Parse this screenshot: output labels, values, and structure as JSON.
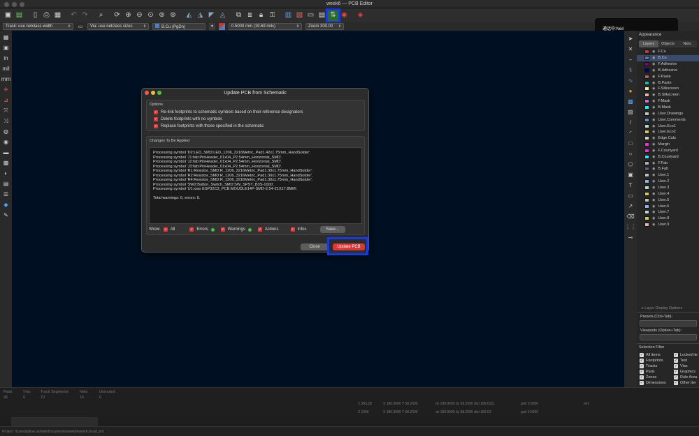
{
  "window": {
    "title": "week6 — PCB Editor"
  },
  "toolbar": {
    "icons": [
      "save-icon",
      "board-setup-icon",
      "page-icon",
      "print-icon",
      "plot-icon",
      "undo-icon",
      "redo-icon",
      "find-icon",
      "refresh-icon",
      "zoom-in-icon",
      "zoom-out-icon",
      "zoom-fit-icon",
      "zoom-objects-icon",
      "zoom-selection-icon",
      "rotate-ccw-icon",
      "rotate-cw-icon",
      "flip-icon",
      "mirror-icon",
      "group-icon",
      "ungroup-icon",
      "lock-icon",
      "unlock-icon",
      "footprint-editor-icon",
      "footprint-browser-icon",
      "update-pcb-from-schematic-icon",
      "drc-icon",
      "scripting-icon"
    ]
  },
  "toolbar2": {
    "track": "Track: use netclass width",
    "via": "Via: use netclass sizes",
    "layer": "B.Cu (PgDn)",
    "grid": "0.5000 mm (19.69 mils)",
    "zoom": "Zoom 300.00"
  },
  "notification": {
    "text": "通话中:Neil"
  },
  "left_tools": [
    "grid-icon",
    "polar-icon",
    "inches-icon",
    "mils-icon",
    "mm-icon",
    "cursor-icon",
    "line-width-icon",
    "ratsnest-icon",
    "curved-ratsnest-icon",
    "pads-icon",
    "vias-icon",
    "tracks-icon",
    "zones-icon",
    "high-contrast-icon",
    "appearance-icon",
    "layers-manager-icon",
    "3d-icon",
    "scripting-tool-icon"
  ],
  "left_tool_glyphs": [
    "▦",
    "▣",
    "in",
    "mil",
    "mm",
    "✛",
    "⊿",
    "⤧",
    "⤨",
    "◍",
    "◉",
    "▬",
    "▩",
    "◐",
    "▤",
    "☰",
    "◆",
    "✎"
  ],
  "right_tools": [
    "select-icon",
    "local-ratsnest-icon",
    "route-track-icon",
    "route-diff-icon",
    "tune-length-icon",
    "add-via-icon",
    "add-zone-icon",
    "add-rule-area-icon",
    "draw-line-icon",
    "draw-arc-icon",
    "draw-rect-icon",
    "draw-circle-icon",
    "draw-polygon-icon",
    "add-image-icon",
    "add-text-icon",
    "add-textbox-icon",
    "add-dimension-icon",
    "delete-icon",
    "grid-origin-icon",
    "measure-icon"
  ],
  "right_tool_glyphs": [
    "➤",
    "✕",
    "⌁",
    "⥮",
    "∿",
    "●",
    "▩",
    "▧",
    "/",
    "◜",
    "□",
    "○",
    "⬠",
    "▣",
    "T",
    "▭",
    "↗",
    "⌫",
    "⋮⋮",
    "⊸"
  ],
  "appearance": {
    "header": "Appearance",
    "tabs": [
      "Layers",
      "Objects",
      "Nets"
    ],
    "active_tab": "Layers",
    "layers": [
      {
        "name": "F.Cu",
        "color": "#c83434"
      },
      {
        "name": "B.Cu",
        "color": "#4d7fc4"
      },
      {
        "name": "F.Adhesive",
        "color": "#84008a"
      },
      {
        "name": "B.Adhesive",
        "color": "#00007c"
      },
      {
        "name": "F.Paste",
        "color": "#b46464"
      },
      {
        "name": "B.Paste",
        "color": "#00c2c2"
      },
      {
        "name": "F.Silkscreen",
        "color": "#f2eda1"
      },
      {
        "name": "B.Silkscreen",
        "color": "#e8b2a7"
      },
      {
        "name": "F.Mask",
        "color": "#d864ff"
      },
      {
        "name": "B.Mask",
        "color": "#02ffee"
      },
      {
        "name": "User.Drawings",
        "color": "#c2c2c2"
      },
      {
        "name": "User.Comments",
        "color": "#5994dc"
      },
      {
        "name": "User.Eco1",
        "color": "#b4db d2"
      },
      {
        "name": "User.Eco2",
        "color": "#d8c852"
      },
      {
        "name": "Edge.Cuts",
        "color": "#d0d2cd"
      },
      {
        "name": "Margin",
        "color": "#ff26e2"
      },
      {
        "name": "F.Courtyard",
        "color": "#ff26e2"
      },
      {
        "name": "B.Courtyard",
        "color": "#26e9ff"
      },
      {
        "name": "F.Fab",
        "color": "#afafaf"
      },
      {
        "name": "B.Fab",
        "color": "#585d84"
      },
      {
        "name": "User.1",
        "color": "#c2c2c2"
      },
      {
        "name": "User.2",
        "color": "#89b4f4"
      },
      {
        "name": "User.3",
        "color": "#b4dbd2"
      },
      {
        "name": "User.4",
        "color": "#d8c852"
      },
      {
        "name": "User.5",
        "color": "#c2c2c2"
      },
      {
        "name": "User.6",
        "color": "#89b4f4"
      },
      {
        "name": "User.7",
        "color": "#b4dbd2"
      },
      {
        "name": "User.8",
        "color": "#d8c852"
      },
      {
        "name": "User.9",
        "color": "#e8b2a7"
      }
    ],
    "layer_display_options": "▸ Layer Display Options",
    "presets_label": "Presets (Ctrl+Tab):",
    "viewports_label": "Viewports (Option+Tab):",
    "selection_filter": "Selection Filter",
    "filters": [
      "All items",
      "Locked ite",
      "Footprints",
      "Text",
      "Tracks",
      "Vias",
      "Pads",
      "Graphics",
      "Zones",
      "Rule Area",
      "Dimensions",
      "Other iter"
    ]
  },
  "status": {
    "items": [
      {
        "label": "Pads",
        "value": "36"
      },
      {
        "label": "Vias",
        "value": "0"
      },
      {
        "label": "Track Segments",
        "value": "70"
      },
      {
        "label": "Nets",
        "value": "15"
      },
      {
        "label": "Unrouted",
        "value": "0"
      }
    ],
    "coords_row1": [
      "Z 283.28",
      "X 180.9000  Y 58.2000",
      "dx 180.9000  dy 58.2000  dist 189.6311",
      "grid 0.5000",
      "mm"
    ],
    "coords_row2": [
      "Z 1066",
      "X 180.9000  Y 58.2000",
      "dx 180.9000  dy 58.2000  dist 189.63",
      "grid 0.5000",
      ""
    ],
    "project_path": "Project: /Users/jialine.us/web/Documents/week6/week6.kicad_pro"
  },
  "dialog": {
    "title": "Update PCB from Schematic",
    "options_header": "Options",
    "options": [
      "Re-link footprints to schematic symbols based on their reference designators",
      "Delete footprints with no symbols",
      "Replace footprints with those specified in the schematic"
    ],
    "changes_header": "Changes To Be Applied",
    "log": [
      "Processing symbol 'D2:LED_SMD:LED_1206_3216Metric_Pad1.42x1.75mm_HandSolder'.",
      "Processing symbol 'J1:fab:PinHeader_01x04_P2.54mm_Horizontal_SMD'.",
      "Processing symbol 'J2:fab:PinHeader_01x04_P2.54mm_Horizontal_SMD'.",
      "Processing symbol 'J3:fab:PinHeader_01x04_P2.54mm_Horizontal_SMD'.",
      "Processing symbol 'R1:Resistor_SMD:R_1206_3216Metric_Pad1.30x1.75mm_HandSolder'.",
      "Processing symbol 'R2:Resistor_SMD:R_1206_3216Metric_Pad1.30x1.75mm_HandSolder'.",
      "Processing symbol 'R4:Resistor_SMD:R_1206_3216Metric_Pad1.30x1.75mm_HandSolder'.",
      "Processing symbol 'SW2:Button_Switch_SMD:SW_SPST_B3S-1000'.",
      "Processing symbol 'U1:xiao ESP32C3_PCB:MOUDLE14P-SMD-2.54-21X17.8MM'.",
      "",
      "Total warnings: 0, errors: 0."
    ],
    "show_label": "Show:",
    "filters": [
      "All",
      "Errors",
      "Warnings",
      "Actions",
      "Infos"
    ],
    "save_label": "Save...",
    "close_label": "Close",
    "update_label": "Update PCB"
  }
}
